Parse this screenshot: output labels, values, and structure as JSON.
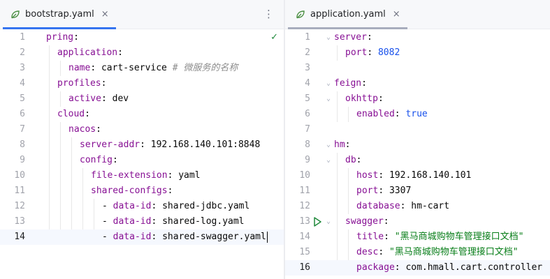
{
  "left_tab": {
    "title": "bootstrap.yaml",
    "close": "×",
    "menu": "⋮"
  },
  "right_tab": {
    "title": "application.yaml",
    "close": "×"
  },
  "colors": {
    "key": "#871094",
    "string": "#067d17",
    "number": "#1750eb",
    "comment": "#8c8c8c",
    "active_tab": "#3574f0",
    "check": "#208a3c"
  },
  "left_editor": {
    "status_icon": "✓",
    "lines": [
      {
        "num": "1",
        "indent": 0,
        "segs": [
          {
            "t": "pring",
            "c": "key"
          },
          {
            "t": ":",
            "c": "punct"
          }
        ]
      },
      {
        "num": "2",
        "indent": 1,
        "segs": [
          {
            "t": "application",
            "c": "key"
          },
          {
            "t": ":",
            "c": "punct"
          }
        ]
      },
      {
        "num": "3",
        "indent": 2,
        "segs": [
          {
            "t": "name",
            "c": "key"
          },
          {
            "t": ": ",
            "c": "punct"
          },
          {
            "t": "cart-service ",
            "c": "text"
          },
          {
            "t": "# 微服务的名称",
            "c": "cmt"
          }
        ]
      },
      {
        "num": "4",
        "indent": 1,
        "segs": [
          {
            "t": "profiles",
            "c": "key"
          },
          {
            "t": ":",
            "c": "punct"
          }
        ]
      },
      {
        "num": "5",
        "indent": 2,
        "segs": [
          {
            "t": "active",
            "c": "key"
          },
          {
            "t": ": ",
            "c": "punct"
          },
          {
            "t": "dev",
            "c": "text"
          }
        ]
      },
      {
        "num": "6",
        "indent": 1,
        "segs": [
          {
            "t": "cloud",
            "c": "key"
          },
          {
            "t": ":",
            "c": "punct"
          }
        ]
      },
      {
        "num": "7",
        "indent": 2,
        "segs": [
          {
            "t": "nacos",
            "c": "key"
          },
          {
            "t": ":",
            "c": "punct"
          }
        ]
      },
      {
        "num": "8",
        "indent": 3,
        "segs": [
          {
            "t": "server-addr",
            "c": "key"
          },
          {
            "t": ": ",
            "c": "punct"
          },
          {
            "t": "192.168.140.101:8848",
            "c": "text"
          }
        ]
      },
      {
        "num": "9",
        "indent": 3,
        "segs": [
          {
            "t": "config",
            "c": "key"
          },
          {
            "t": ":",
            "c": "punct"
          }
        ]
      },
      {
        "num": "10",
        "indent": 4,
        "segs": [
          {
            "t": "file-extension",
            "c": "key"
          },
          {
            "t": ": ",
            "c": "punct"
          },
          {
            "t": "yaml",
            "c": "text"
          }
        ]
      },
      {
        "num": "11",
        "indent": 4,
        "segs": [
          {
            "t": "shared-configs",
            "c": "key"
          },
          {
            "t": ":",
            "c": "punct"
          }
        ]
      },
      {
        "num": "12",
        "indent": 5,
        "segs": [
          {
            "t": "- ",
            "c": "punct"
          },
          {
            "t": "data-id",
            "c": "key"
          },
          {
            "t": ": ",
            "c": "punct"
          },
          {
            "t": "shared-jdbc.yaml",
            "c": "text"
          }
        ]
      },
      {
        "num": "13",
        "indent": 5,
        "segs": [
          {
            "t": "- ",
            "c": "punct"
          },
          {
            "t": "data-id",
            "c": "key"
          },
          {
            "t": ": ",
            "c": "punct"
          },
          {
            "t": "shared-log.yaml",
            "c": "text"
          }
        ]
      },
      {
        "num": "14",
        "indent": 5,
        "current": true,
        "segs": [
          {
            "t": "- ",
            "c": "punct"
          },
          {
            "t": "data-id",
            "c": "key"
          },
          {
            "t": ": ",
            "c": "punct"
          },
          {
            "t": "shared-swagger.yaml",
            "c": "text"
          }
        ]
      }
    ]
  },
  "right_editor": {
    "lines": [
      {
        "num": "1",
        "indent": 0,
        "fold": "⌄",
        "segs": [
          {
            "t": "server",
            "c": "key"
          },
          {
            "t": ":",
            "c": "punct"
          }
        ]
      },
      {
        "num": "2",
        "indent": 1,
        "segs": [
          {
            "t": "port",
            "c": "key"
          },
          {
            "t": ": ",
            "c": "punct"
          },
          {
            "t": "8082",
            "c": "num"
          }
        ]
      },
      {
        "num": "3",
        "indent": 0,
        "segs": []
      },
      {
        "num": "4",
        "indent": 0,
        "fold": "⌄",
        "segs": [
          {
            "t": "feign",
            "c": "key"
          },
          {
            "t": ":",
            "c": "punct"
          }
        ]
      },
      {
        "num": "5",
        "indent": 1,
        "fold": "⌄",
        "segs": [
          {
            "t": "okhttp",
            "c": "key"
          },
          {
            "t": ":",
            "c": "punct"
          }
        ]
      },
      {
        "num": "6",
        "indent": 2,
        "segs": [
          {
            "t": "enabled",
            "c": "key"
          },
          {
            "t": ": ",
            "c": "punct"
          },
          {
            "t": "true",
            "c": "num"
          }
        ]
      },
      {
        "num": "7",
        "indent": 0,
        "segs": []
      },
      {
        "num": "8",
        "indent": 0,
        "fold": "⌄",
        "segs": [
          {
            "t": "hm",
            "c": "key"
          },
          {
            "t": ":",
            "c": "punct"
          }
        ]
      },
      {
        "num": "9",
        "indent": 1,
        "fold": "⌄",
        "segs": [
          {
            "t": "db",
            "c": "key"
          },
          {
            "t": ":",
            "c": "punct"
          }
        ]
      },
      {
        "num": "10",
        "indent": 2,
        "segs": [
          {
            "t": "host",
            "c": "key"
          },
          {
            "t": ": ",
            "c": "punct"
          },
          {
            "t": "192.168.140.101",
            "c": "text"
          }
        ]
      },
      {
        "num": "11",
        "indent": 2,
        "segs": [
          {
            "t": "port",
            "c": "key"
          },
          {
            "t": ": ",
            "c": "punct"
          },
          {
            "t": "3307",
            "c": "text"
          }
        ]
      },
      {
        "num": "12",
        "indent": 2,
        "segs": [
          {
            "t": "database",
            "c": "key"
          },
          {
            "t": ": ",
            "c": "punct"
          },
          {
            "t": "hm-cart",
            "c": "text"
          }
        ]
      },
      {
        "num": "13",
        "indent": 1,
        "fold": "⌄",
        "run": true,
        "segs": [
          {
            "t": "swagger",
            "c": "key"
          },
          {
            "t": ":",
            "c": "punct"
          }
        ]
      },
      {
        "num": "14",
        "indent": 2,
        "segs": [
          {
            "t": "title",
            "c": "key"
          },
          {
            "t": ": ",
            "c": "punct"
          },
          {
            "t": "\"黑马商城购物车管理接口文档\"",
            "c": "val"
          }
        ]
      },
      {
        "num": "15",
        "indent": 2,
        "segs": [
          {
            "t": "desc",
            "c": "key"
          },
          {
            "t": ": ",
            "c": "punct"
          },
          {
            "t": "\"黑马商城购物车管理接口文档\"",
            "c": "val"
          }
        ]
      },
      {
        "num": "16",
        "indent": 2,
        "current": true,
        "segs": [
          {
            "t": "package",
            "c": "key"
          },
          {
            "t": ": ",
            "c": "punct"
          },
          {
            "t": "com.hmall.cart.controller",
            "c": "text"
          }
        ]
      }
    ]
  }
}
